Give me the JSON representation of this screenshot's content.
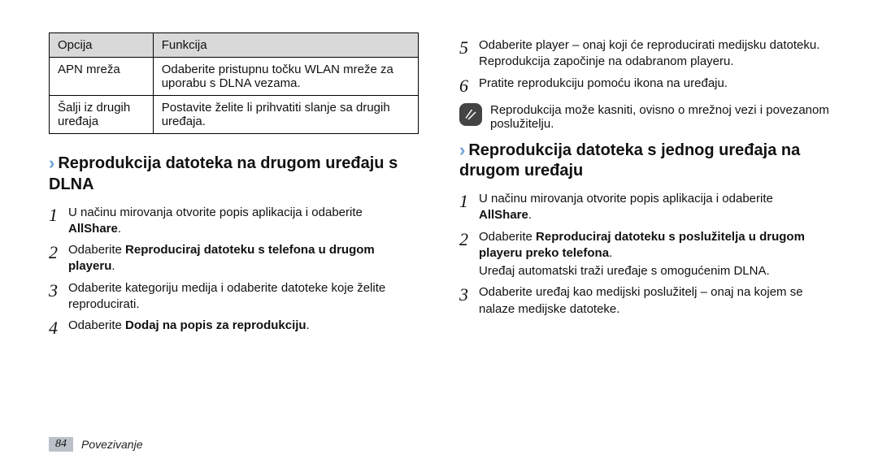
{
  "table": {
    "headers": [
      "Opcija",
      "Funkcija"
    ],
    "rows": [
      [
        "APN mreža",
        "Odaberite pristupnu točku WLAN mreže za uporabu s DLNA vezama."
      ],
      [
        "Šalji iz drugih uređaja",
        "Postavite želite li prihvatiti slanje sa drugih uređaja."
      ]
    ]
  },
  "left": {
    "heading": "Reprodukcija datoteka na drugom uređaju s DLNA",
    "s1a": "U načinu mirovanja otvorite popis aplikacija i odaberite ",
    "s1b": "AllShare",
    "s1c": ".",
    "s2a": "Odaberite ",
    "s2b": "Reproduciraj datoteku s telefona u drugom playeru",
    "s2c": ".",
    "s3": "Odaberite kategoriju medija i odaberite datoteke koje želite reproducirati.",
    "s4a": "Odaberite ",
    "s4b": "Dodaj na popis za reprodukciju",
    "s4c": "."
  },
  "right": {
    "s5": "Odaberite player – onaj koji će reproducirati medijsku datoteku. Reprodukcija započinje na odabranom playeru.",
    "s6": "Pratite reprodukciju pomoću ikona na uređaju.",
    "note": "Reprodukcija može kasniti, ovisno o mrežnoj vezi i povezanom poslužitelju.",
    "heading": "Reprodukcija datoteka s jednog uređaja na drugom uređaju",
    "s1a": "U načinu mirovanja otvorite popis aplikacija i odaberite ",
    "s1b": "AllShare",
    "s1c": ".",
    "s2a": "Odaberite ",
    "s2b": "Reproduciraj datoteku s poslužitelja u drugom playeru preko telefona",
    "s2c": ".",
    "s2d": "Uređaj automatski traži uređaje s omogućenim DLNA.",
    "s3": "Odaberite uređaj kao medijski poslužitelj – onaj na kojem se nalaze medijske datoteke."
  },
  "footer": {
    "page": "84",
    "section": "Povezivanje"
  }
}
